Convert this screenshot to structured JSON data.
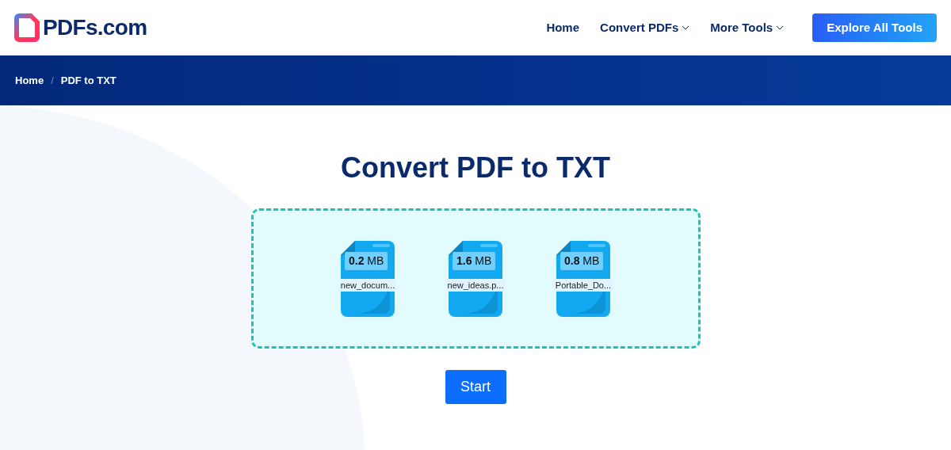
{
  "header": {
    "logo": "PDFs.com",
    "nav": [
      {
        "label": "Home",
        "dropdown": false
      },
      {
        "label": "Convert PDFs",
        "dropdown": true
      },
      {
        "label": "More Tools",
        "dropdown": true
      }
    ],
    "cta": "Explore All Tools"
  },
  "breadcrumb": {
    "separator": "/",
    "items": [
      "Home",
      "PDF to TXT"
    ]
  },
  "title": "Convert PDF to TXT",
  "files": [
    {
      "size": "**0.2** MB",
      "name": "new_docum..."
    },
    {
      "size": "**1.6** MB",
      "name": "new_ideas.p..."
    },
    {
      "size": "**0.8** MB",
      "name": "Portable_Do..."
    }
  ],
  "start_button": "Start"
}
